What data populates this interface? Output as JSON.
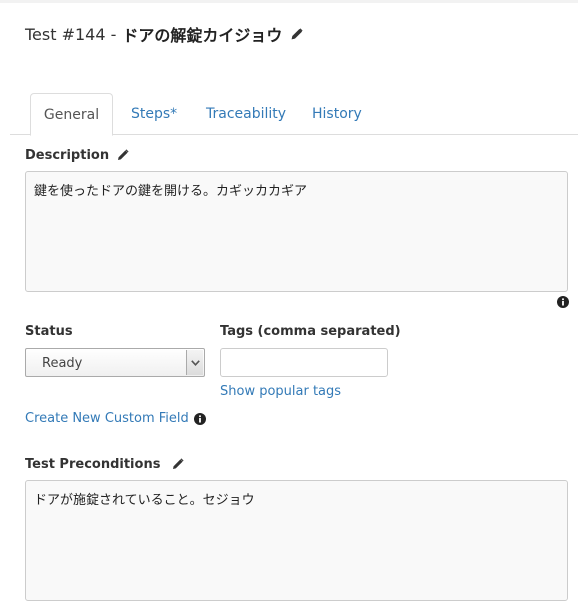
{
  "header": {
    "test_prefix": "Test #144 -",
    "test_name": "ドアの解錠カイジョウ"
  },
  "tabs": [
    {
      "label": "General",
      "active": true
    },
    {
      "label": "Steps*",
      "active": false
    },
    {
      "label": "Traceability",
      "active": false
    },
    {
      "label": "History",
      "active": false
    }
  ],
  "description": {
    "label": "Description",
    "text": "鍵を使ったドアの鍵を開ける。カギッカカギア"
  },
  "status": {
    "label": "Status",
    "selected": "Ready"
  },
  "tags": {
    "label": "Tags (comma separated)",
    "value": "",
    "popular_link": "Show popular tags"
  },
  "custom_field_link": "Create New Custom Field",
  "preconditions": {
    "label": "Test Preconditions",
    "text": "ドアが施錠されていること。セジョウ"
  },
  "colors": {
    "link": "#337ab7",
    "text": "#333333",
    "border": "#cccccc",
    "field_bg": "#f9f9f9"
  },
  "icons": {
    "edit": "pencil-icon",
    "info": "info-circle-icon",
    "dropdown": "chevron-down-icon"
  }
}
